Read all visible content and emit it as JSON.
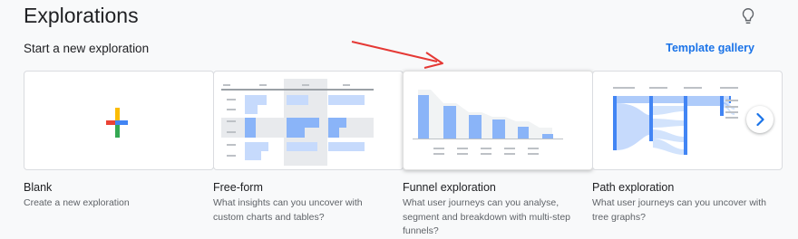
{
  "page": {
    "title": "Explorations"
  },
  "section": {
    "title": "Start a new exploration",
    "template_link": "Template gallery"
  },
  "cards": [
    {
      "name": "Blank",
      "description": "Create a new exploration"
    },
    {
      "name": "Free-form",
      "description": "What insights can you uncover with custom charts and tables?"
    },
    {
      "name": "Funnel exploration",
      "description": "What user journeys can you analyse, segment and breakdown with multi-step funnels?"
    },
    {
      "name": "Path exploration",
      "description": "What user journeys can you uncover with tree graphs?"
    }
  ],
  "icons": {
    "help": "lightbulb-icon",
    "next": "chevron-right-icon",
    "add": "plus-icon"
  },
  "colors": {
    "accent": "#1a73e8",
    "annotation_arrow": "#e53935"
  }
}
